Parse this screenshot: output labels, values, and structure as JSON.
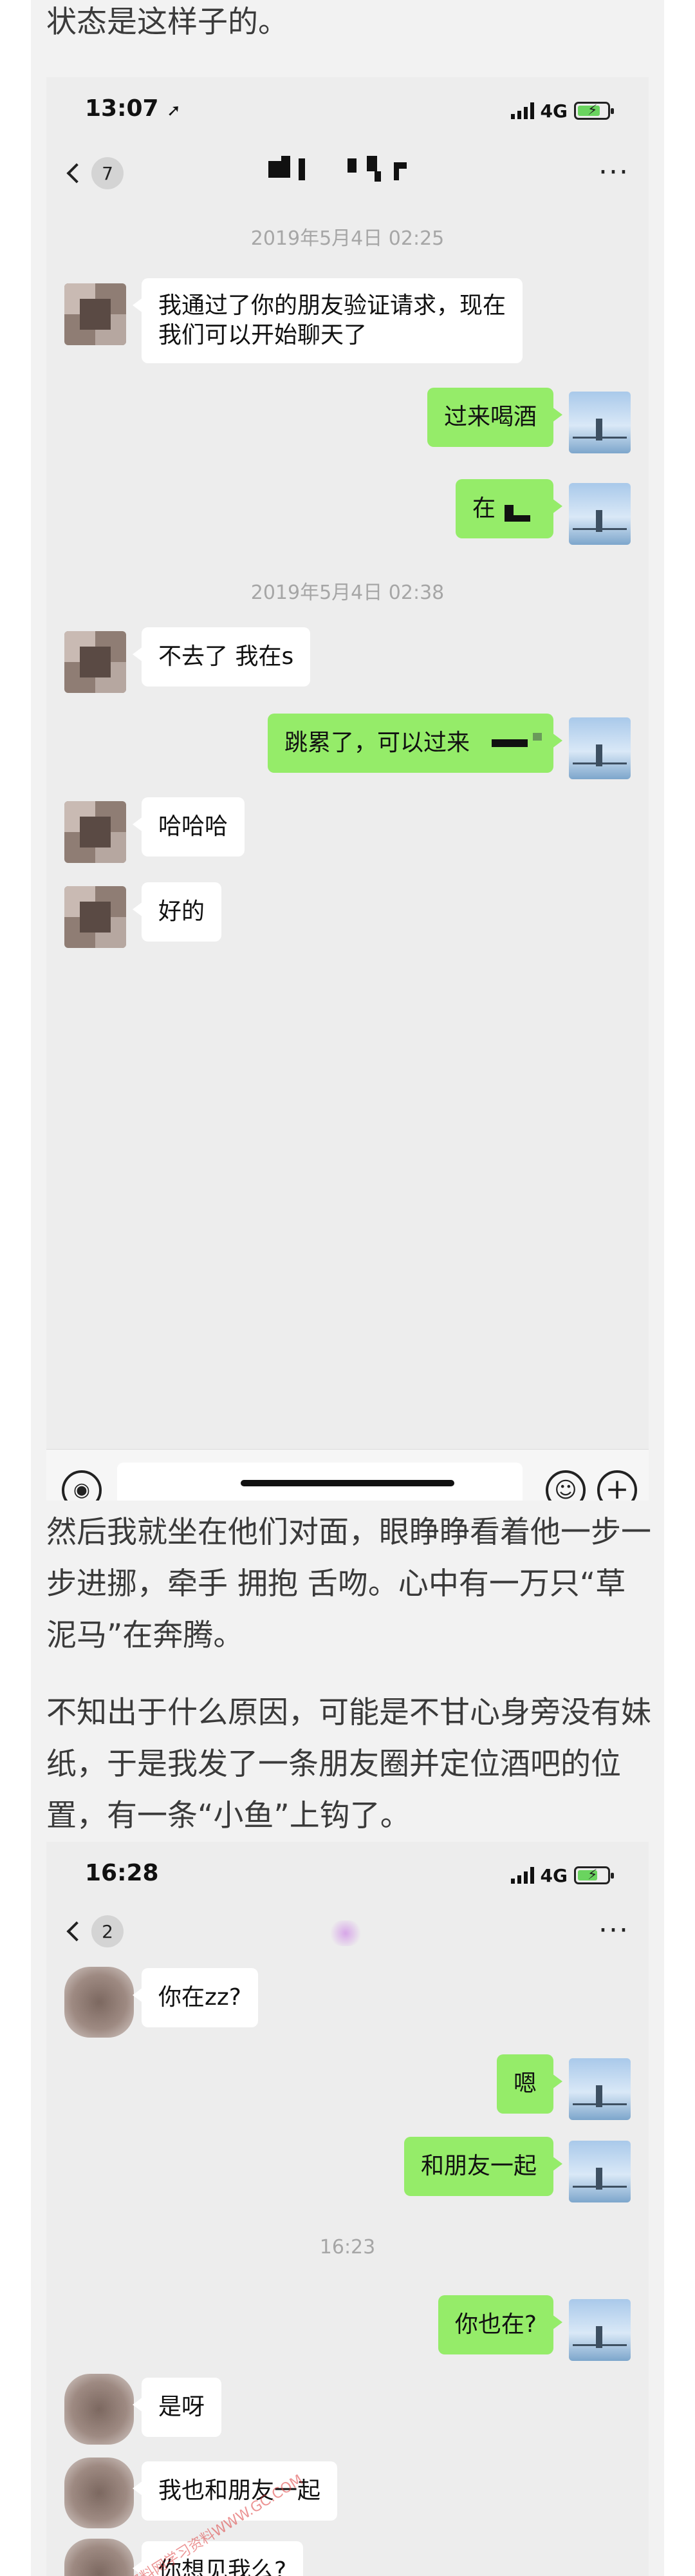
{
  "article": {
    "intro_text": "状态是这样子的。",
    "paragraph_1": " 然后我就坐在他们对面，眼睁睁看着他一步一步进挪，牵手 拥抱 舌吻。心中有一万只“草泥马”在奔腾。",
    "paragraph_2": "不知出于什么原因，可能是不甘心身旁没有妹纸，于是我发了一条朋友圈并定位酒吧的位置，有一条“小鱼”上钩了。"
  },
  "screenshot_1": {
    "status_time": "13:07",
    "location_arrow": "➚",
    "network": "4G",
    "back_badge": "7",
    "more_label": "···",
    "messages": [
      {
        "type": "timestamp",
        "text": "2019年5月4日 02:25"
      },
      {
        "side": "left",
        "text": "我通过了你的朋友验证请求，现在\n我们可以开始聊天了"
      },
      {
        "side": "right",
        "text": "过来喝酒"
      },
      {
        "side": "right",
        "text": "在"
      },
      {
        "type": "timestamp",
        "text": "2019年5月4日 02:38"
      },
      {
        "side": "left",
        "text": "不去了 我在s"
      },
      {
        "side": "right",
        "text": "跳累了，可以过来"
      },
      {
        "side": "left",
        "text": "哈哈哈"
      },
      {
        "side": "left",
        "text": "好的"
      }
    ],
    "input_icons": {
      "voice": "voice-icon",
      "emoji": "emoji-icon",
      "plus": "plus-icon"
    }
  },
  "screenshot_2": {
    "status_time": "16:28",
    "network": "4G",
    "back_badge": "2",
    "more_label": "···",
    "messages": [
      {
        "side": "left",
        "text": "你在zz?"
      },
      {
        "side": "right",
        "text": "嗯"
      },
      {
        "side": "right",
        "text": "和朋友一起"
      },
      {
        "type": "timestamp",
        "text": "16:23"
      },
      {
        "side": "right",
        "text": "你也在?"
      },
      {
        "side": "left",
        "text": "是呀"
      },
      {
        "side": "left",
        "text": "我也和朋友一起"
      },
      {
        "side": "left",
        "text": "你想见我么?"
      }
    ]
  },
  "watermark_text": "资料网学习资料WWW.GC.COM",
  "colors": {
    "chat_background": "#ededed",
    "bubble_self": "#95ec69",
    "bubble_other": "#ffffff",
    "timestamp_text": "#a6a6a6",
    "article_text": "#3a3a3a"
  }
}
